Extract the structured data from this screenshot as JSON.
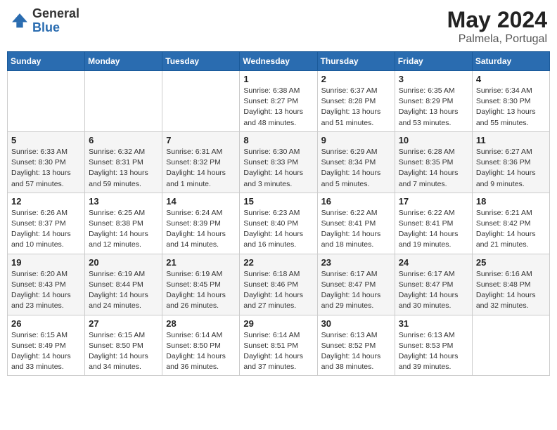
{
  "header": {
    "logo_general": "General",
    "logo_blue": "Blue",
    "month_year": "May 2024",
    "location": "Palmela, Portugal"
  },
  "days_of_week": [
    "Sunday",
    "Monday",
    "Tuesday",
    "Wednesday",
    "Thursday",
    "Friday",
    "Saturday"
  ],
  "weeks": [
    [
      {
        "day": "",
        "info": ""
      },
      {
        "day": "",
        "info": ""
      },
      {
        "day": "",
        "info": ""
      },
      {
        "day": "1",
        "info": "Sunrise: 6:38 AM\nSunset: 8:27 PM\nDaylight: 13 hours\nand 48 minutes."
      },
      {
        "day": "2",
        "info": "Sunrise: 6:37 AM\nSunset: 8:28 PM\nDaylight: 13 hours\nand 51 minutes."
      },
      {
        "day": "3",
        "info": "Sunrise: 6:35 AM\nSunset: 8:29 PM\nDaylight: 13 hours\nand 53 minutes."
      },
      {
        "day": "4",
        "info": "Sunrise: 6:34 AM\nSunset: 8:30 PM\nDaylight: 13 hours\nand 55 minutes."
      }
    ],
    [
      {
        "day": "5",
        "info": "Sunrise: 6:33 AM\nSunset: 8:30 PM\nDaylight: 13 hours\nand 57 minutes."
      },
      {
        "day": "6",
        "info": "Sunrise: 6:32 AM\nSunset: 8:31 PM\nDaylight: 13 hours\nand 59 minutes."
      },
      {
        "day": "7",
        "info": "Sunrise: 6:31 AM\nSunset: 8:32 PM\nDaylight: 14 hours\nand 1 minute."
      },
      {
        "day": "8",
        "info": "Sunrise: 6:30 AM\nSunset: 8:33 PM\nDaylight: 14 hours\nand 3 minutes."
      },
      {
        "day": "9",
        "info": "Sunrise: 6:29 AM\nSunset: 8:34 PM\nDaylight: 14 hours\nand 5 minutes."
      },
      {
        "day": "10",
        "info": "Sunrise: 6:28 AM\nSunset: 8:35 PM\nDaylight: 14 hours\nand 7 minutes."
      },
      {
        "day": "11",
        "info": "Sunrise: 6:27 AM\nSunset: 8:36 PM\nDaylight: 14 hours\nand 9 minutes."
      }
    ],
    [
      {
        "day": "12",
        "info": "Sunrise: 6:26 AM\nSunset: 8:37 PM\nDaylight: 14 hours\nand 10 minutes."
      },
      {
        "day": "13",
        "info": "Sunrise: 6:25 AM\nSunset: 8:38 PM\nDaylight: 14 hours\nand 12 minutes."
      },
      {
        "day": "14",
        "info": "Sunrise: 6:24 AM\nSunset: 8:39 PM\nDaylight: 14 hours\nand 14 minutes."
      },
      {
        "day": "15",
        "info": "Sunrise: 6:23 AM\nSunset: 8:40 PM\nDaylight: 14 hours\nand 16 minutes."
      },
      {
        "day": "16",
        "info": "Sunrise: 6:22 AM\nSunset: 8:41 PM\nDaylight: 14 hours\nand 18 minutes."
      },
      {
        "day": "17",
        "info": "Sunrise: 6:22 AM\nSunset: 8:41 PM\nDaylight: 14 hours\nand 19 minutes."
      },
      {
        "day": "18",
        "info": "Sunrise: 6:21 AM\nSunset: 8:42 PM\nDaylight: 14 hours\nand 21 minutes."
      }
    ],
    [
      {
        "day": "19",
        "info": "Sunrise: 6:20 AM\nSunset: 8:43 PM\nDaylight: 14 hours\nand 23 minutes."
      },
      {
        "day": "20",
        "info": "Sunrise: 6:19 AM\nSunset: 8:44 PM\nDaylight: 14 hours\nand 24 minutes."
      },
      {
        "day": "21",
        "info": "Sunrise: 6:19 AM\nSunset: 8:45 PM\nDaylight: 14 hours\nand 26 minutes."
      },
      {
        "day": "22",
        "info": "Sunrise: 6:18 AM\nSunset: 8:46 PM\nDaylight: 14 hours\nand 27 minutes."
      },
      {
        "day": "23",
        "info": "Sunrise: 6:17 AM\nSunset: 8:47 PM\nDaylight: 14 hours\nand 29 minutes."
      },
      {
        "day": "24",
        "info": "Sunrise: 6:17 AM\nSunset: 8:47 PM\nDaylight: 14 hours\nand 30 minutes."
      },
      {
        "day": "25",
        "info": "Sunrise: 6:16 AM\nSunset: 8:48 PM\nDaylight: 14 hours\nand 32 minutes."
      }
    ],
    [
      {
        "day": "26",
        "info": "Sunrise: 6:15 AM\nSunset: 8:49 PM\nDaylight: 14 hours\nand 33 minutes."
      },
      {
        "day": "27",
        "info": "Sunrise: 6:15 AM\nSunset: 8:50 PM\nDaylight: 14 hours\nand 34 minutes."
      },
      {
        "day": "28",
        "info": "Sunrise: 6:14 AM\nSunset: 8:50 PM\nDaylight: 14 hours\nand 36 minutes."
      },
      {
        "day": "29",
        "info": "Sunrise: 6:14 AM\nSunset: 8:51 PM\nDaylight: 14 hours\nand 37 minutes."
      },
      {
        "day": "30",
        "info": "Sunrise: 6:13 AM\nSunset: 8:52 PM\nDaylight: 14 hours\nand 38 minutes."
      },
      {
        "day": "31",
        "info": "Sunrise: 6:13 AM\nSunset: 8:53 PM\nDaylight: 14 hours\nand 39 minutes."
      },
      {
        "day": "",
        "info": ""
      }
    ]
  ]
}
